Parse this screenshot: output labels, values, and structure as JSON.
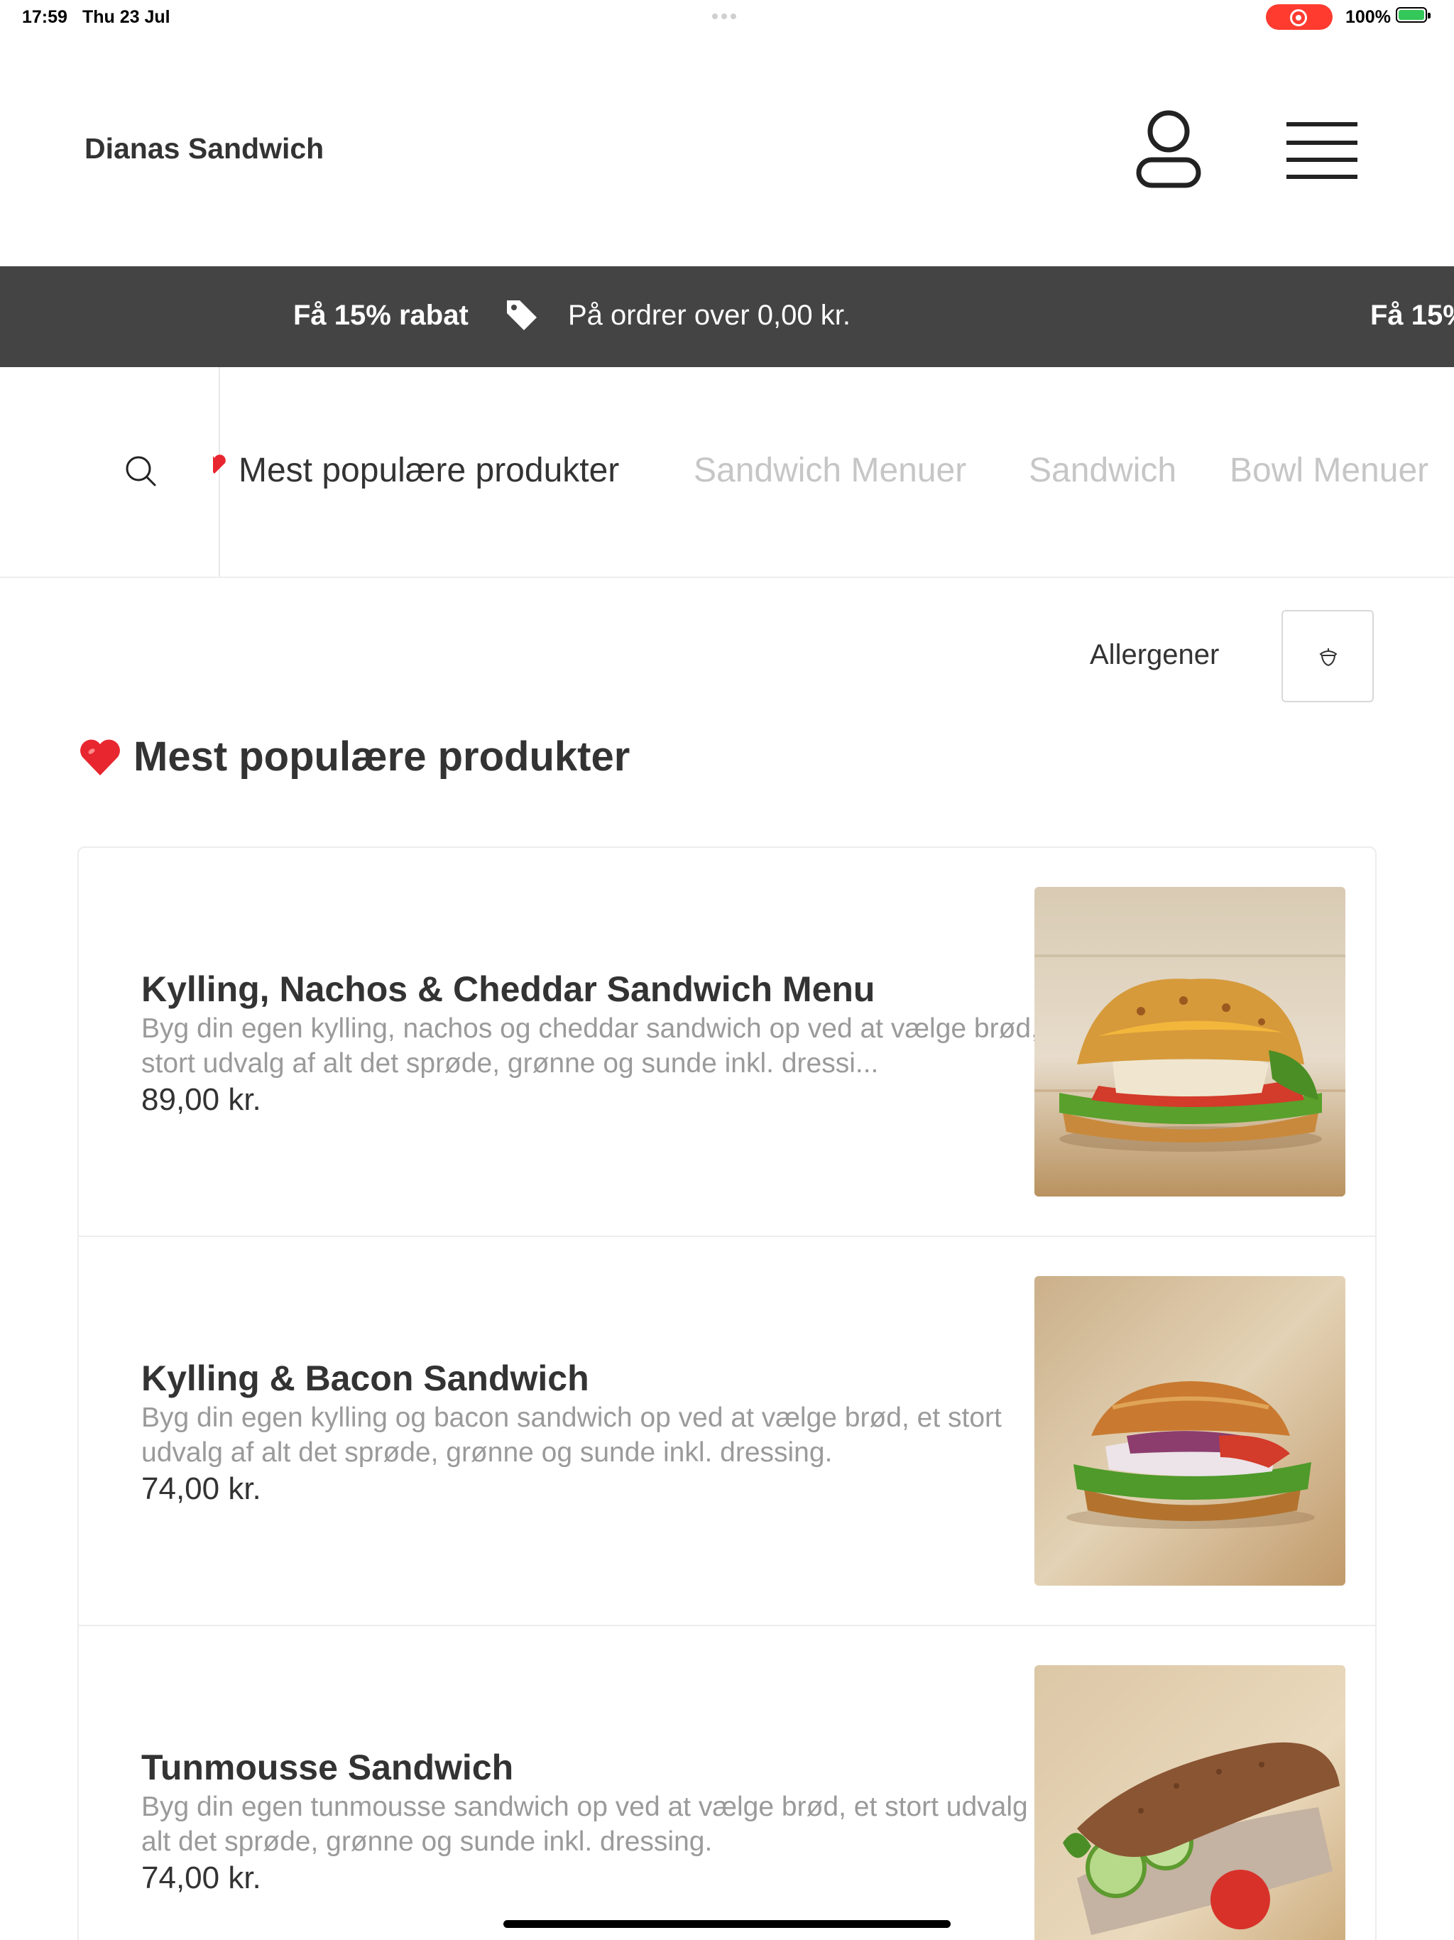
{
  "status_bar": {
    "time": "17:59",
    "date": "Thu 23 Jul",
    "battery": "100%"
  },
  "header": {
    "brand": "Dianas Sandwich"
  },
  "promo": {
    "title": "Få 15% rabat",
    "text": "På ordrer over 0,00 kr.",
    "title_repeat": "Få 15%"
  },
  "categories": [
    {
      "label": "Mest populære produkter"
    },
    {
      "label": "Sandwich Menuer"
    },
    {
      "label": "Sandwich"
    },
    {
      "label": "Bowl Menuer"
    }
  ],
  "filter": {
    "allergens_label": "Allergener"
  },
  "section": {
    "title": "Mest populære produkter"
  },
  "products": [
    {
      "name": "Kylling, Nachos & Cheddar Sandwich Menu",
      "description": "Byg din egen kylling, nachos og cheddar sandwich op ved at vælge brød, et stort udvalg af alt det sprøde, grønne og sunde inkl. dressi...",
      "price": "89,00 kr."
    },
    {
      "name": "Kylling & Bacon Sandwich",
      "description": "Byg din egen kylling og bacon sandwich op ved at vælge brød, et stort udvalg af alt det sprøde, grønne og sunde inkl. dressing.",
      "price": "74,00 kr."
    },
    {
      "name": "Tunmousse Sandwich",
      "description": "Byg din egen tunmousse sandwich op ved at vælge brød, et stort udvalg af alt det sprøde, grønne og sunde inkl. dressing.",
      "price": "74,00 kr."
    }
  ],
  "colors": {
    "promo_bg": "#444444",
    "text": "#333333",
    "muted": "#9a9a9a",
    "inactive_tab": "#c6c6c6",
    "record": "#ff3b30",
    "heart": "#e8262f"
  },
  "icons": [
    "user-icon",
    "hamburger-menu-icon",
    "tag-icon",
    "search-icon",
    "heart-icon",
    "acorn-icon"
  ]
}
